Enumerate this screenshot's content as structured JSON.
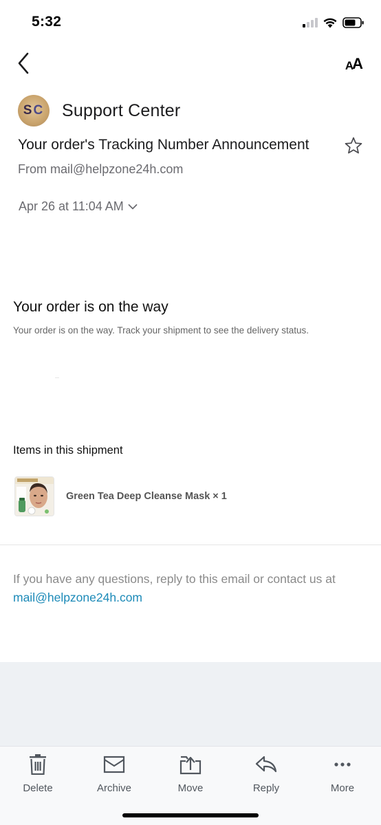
{
  "status_bar": {
    "time": "5:32",
    "signal_level": 0.25,
    "battery_level": 0.6
  },
  "nav": {
    "back_icon": "chevron-left-icon",
    "text_size_label_small": "A",
    "text_size_label_big": "A"
  },
  "email": {
    "avatar_initials": [
      "S",
      "C"
    ],
    "sender_name": "Support Center",
    "subject": "Your order's Tracking Number Announcement",
    "from_line": "From mail@helpzone24h.com",
    "date": "Apr 26 at 11:04 AM",
    "starred": false
  },
  "body": {
    "headline": "Your order is on the way",
    "subtext": "Your order is on the way. Track your shipment to see the delivery status.",
    "items_heading": "Items in this shipment",
    "product": {
      "name": "Green Tea Deep Cleanse Mask × 1"
    },
    "help_text": "If you have any questions, reply to this email or contact us at",
    "help_email": "mail@helpzone24h.com"
  },
  "toolbar": {
    "items": [
      {
        "label": "Delete",
        "icon": "trash-icon"
      },
      {
        "label": "Archive",
        "icon": "archive-icon"
      },
      {
        "label": "Move",
        "icon": "move-icon"
      },
      {
        "label": "Reply",
        "icon": "reply-icon"
      },
      {
        "label": "More",
        "icon": "more-icon"
      }
    ]
  },
  "colors": {
    "link": "#1c8ab8",
    "secondary_text": "#6b6b70",
    "toolbar_bg": "#f8f9fa",
    "gray_area": "#eef1f4"
  }
}
